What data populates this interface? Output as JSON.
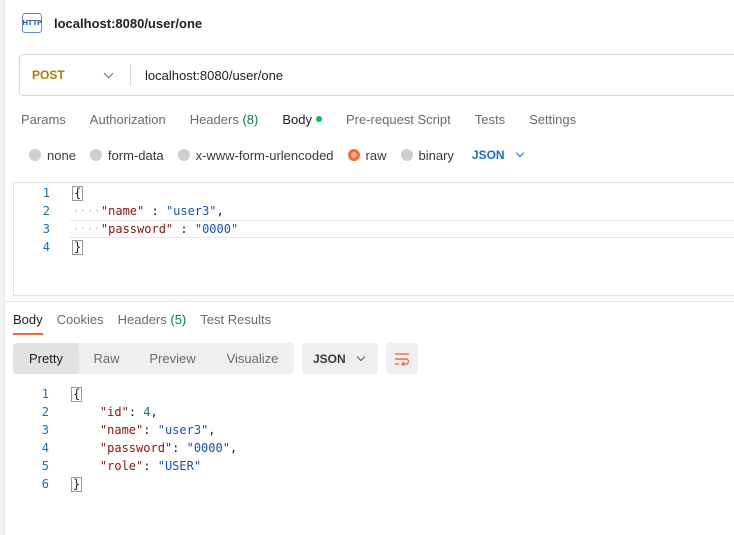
{
  "tab": {
    "title": "localhost:8080/user/one",
    "icon": "http-file-icon",
    "icon_text": "HTTP"
  },
  "request": {
    "method": "POST",
    "url": "localhost:8080/user/one"
  },
  "request_tabs": [
    {
      "label": "Params"
    },
    {
      "label": "Authorization"
    },
    {
      "label": "Headers",
      "count": "(8)"
    },
    {
      "label": "Body",
      "active": true
    },
    {
      "label": "Pre-request Script"
    },
    {
      "label": "Tests"
    },
    {
      "label": "Settings"
    }
  ],
  "body_types": [
    {
      "label": "none",
      "checked": false
    },
    {
      "label": "form-data",
      "checked": false
    },
    {
      "label": "x-www-form-urlencoded",
      "checked": false
    },
    {
      "label": "raw",
      "checked": true
    },
    {
      "label": "binary",
      "checked": false
    }
  ],
  "body_language": "JSON",
  "request_body_lines": [
    {
      "n": "1",
      "text": "{"
    },
    {
      "n": "2",
      "key": "\"name\"",
      "sep": " : ",
      "value": "\"user3\"",
      "trail": ","
    },
    {
      "n": "3",
      "key": "\"password\"",
      "sep": " : ",
      "value": "\"0000\"",
      "trail": ""
    },
    {
      "n": "4",
      "text": "}"
    }
  ],
  "response_tabs": [
    {
      "label": "Body",
      "active": true
    },
    {
      "label": "Cookies"
    },
    {
      "label": "Headers",
      "count": "(5)"
    },
    {
      "label": "Test Results"
    }
  ],
  "view_tabs": [
    {
      "label": "Pretty",
      "active": true
    },
    {
      "label": "Raw"
    },
    {
      "label": "Preview"
    },
    {
      "label": "Visualize"
    }
  ],
  "response_format": "JSON",
  "response_lines": [
    {
      "n": "1",
      "text": "{"
    },
    {
      "n": "2",
      "key": "\"id\"",
      "value": "4",
      "kind": "num",
      "trail": ","
    },
    {
      "n": "3",
      "key": "\"name\"",
      "value": "\"user3\"",
      "kind": "str",
      "trail": ","
    },
    {
      "n": "4",
      "key": "\"password\"",
      "value": "\"0000\"",
      "kind": "str",
      "trail": ","
    },
    {
      "n": "5",
      "key": "\"role\"",
      "value": "\"USER\"",
      "kind": "str",
      "trail": ""
    },
    {
      "n": "6",
      "text": "}"
    }
  ],
  "colors": {
    "accent": "#f26b3a",
    "method": "#ad7a03",
    "link_blue": "#1d6acb",
    "status_green": "#0cbb52"
  }
}
